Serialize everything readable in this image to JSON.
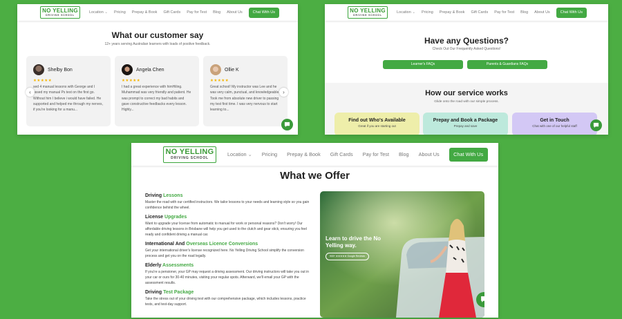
{
  "nav": {
    "logo_line1": "NO YELLING",
    "logo_line2": "DRIVING SCHOOL",
    "items": [
      "Location",
      "Pricing",
      "Prepay & Book",
      "Gift Cards",
      "Pay for Test",
      "Blog",
      "About Us"
    ],
    "chat_button": "Chat With Us"
  },
  "reviews_section": {
    "title": "What our customer say",
    "subtitle": "12+ years serving Australian learners with loads of positive feedback.",
    "reviews": [
      {
        "name": "Shelby Bon",
        "stars": "★★★★★",
        "text": "sed 4 manual lessons with George and I pssed my manual Ps test on the first go. Without him I believe i would have failed. He supported and helped me through my nerves, if you're looking for a manu..."
      },
      {
        "name": "Angela Chen",
        "stars": "★★★★★",
        "text": "I had a great experience with himHiling. Muhammad was very friendly and patient. He was prompt to correct my bad habits and gave constructive feedbacks every lesson. Highly..."
      },
      {
        "name": "Ollie K",
        "stars": "★★★★★",
        "text": "Great school! My instructor was Lee and he was very calm, punctual, and knowledgeable. Took me from absolute new driver to passing my test first time. I was very nervous to start learning to..."
      }
    ],
    "prev_icon": "‹",
    "next_icon": "›"
  },
  "faq_section": {
    "title": "Have any Questions?",
    "subtitle": "Check Out Our Frequently Asked Questions!",
    "buttons": [
      "Learner's FAQs",
      "Parents & Guardians FAQs"
    ]
  },
  "service_section": {
    "title": "How our service works",
    "subtitle": "Glide onto the road with our simple process.",
    "cards": [
      {
        "title": "Find out Who's Available",
        "sub": "Great if you are starting out"
      },
      {
        "title": "Prepay and Book a Package",
        "sub": "Prepay and save"
      },
      {
        "title": "Get in Touch",
        "sub": "Chat with one of our helpful staff"
      }
    ]
  },
  "offer_section": {
    "title": "What we Offer",
    "items": [
      {
        "head_plain": "Driving ",
        "head_hl": "Lessons",
        "desc": "Master the road with our certified instructors. We tailor lessons to your needs and learning style so you gain confidence behind the wheel."
      },
      {
        "head_plain": "License ",
        "head_hl": "Upgrades",
        "desc": "Want to upgrade your license from automatic to manual for work or personal reasons? Don't worry! Our affordable driving lessons in Brisbane will help you get used to the clutch and gear stick, ensuring you feel ready and confident driving a manual car."
      },
      {
        "head_plain": "International And ",
        "head_hl": "Overseas Licence Conversions",
        "desc": "Get your international driver's license recognized here. No Yelling Driving School simplify the conversion process and get you on the road legally."
      },
      {
        "head_plain": "Elderly ",
        "head_hl": "Assessments",
        "desc": "If you're a pensioner, your GP may request a driving assessment. Our driving instructors will take you out in your car or ours for 30-40 minutes, visiting your regular spots. Afterward, we'll email your GP with the assessment results."
      },
      {
        "head_plain": "Driving ",
        "head_hl": "Test Package",
        "desc": "Take the stress out of your driving test with our comprehensive package, which includes lessons, practice tests, and test-day support."
      }
    ],
    "photo_heading": "Learn to drive the No Yelling way.",
    "photo_badge": "900+ ★★★★★ Google Reviews"
  },
  "colors": {
    "brand_green": "#43a943",
    "page_bg": "#4cae43",
    "star": "#f5b400"
  }
}
